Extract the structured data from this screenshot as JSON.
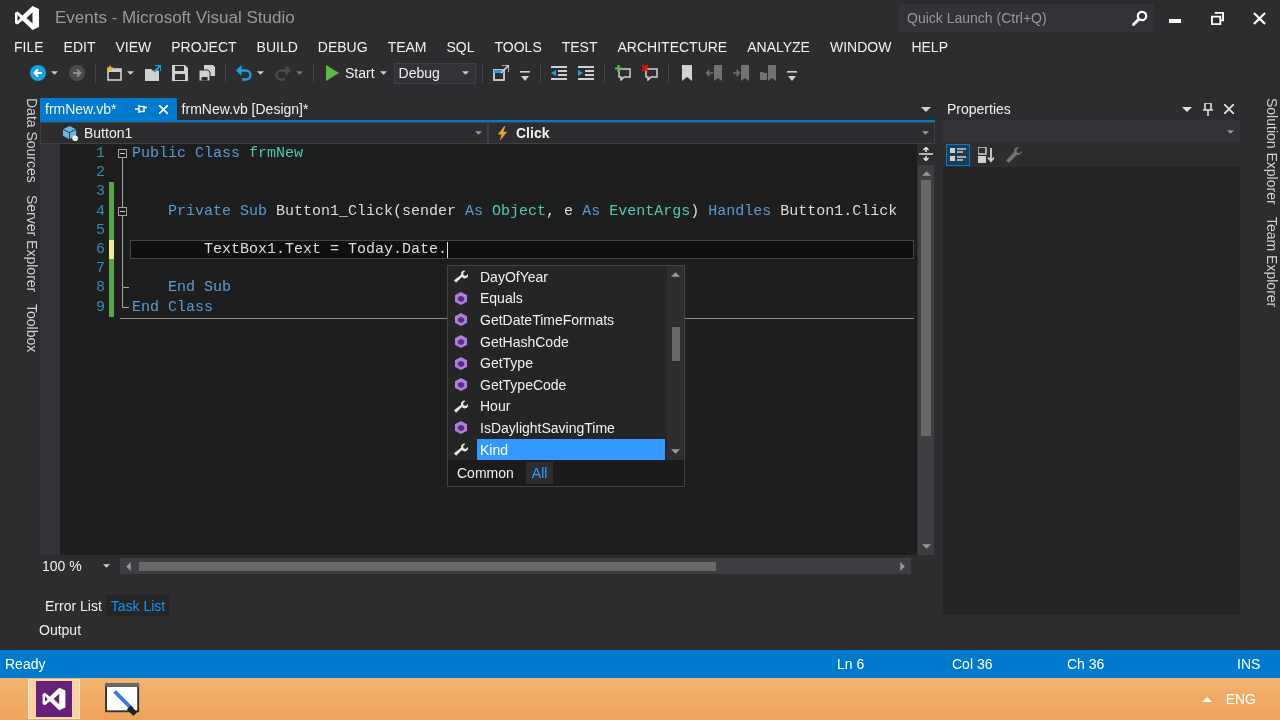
{
  "window": {
    "title": "Events - Microsoft Visual Studio"
  },
  "quick_launch": {
    "placeholder": "Quick Launch (Ctrl+Q)"
  },
  "menu": [
    "FILE",
    "EDIT",
    "VIEW",
    "PROJECT",
    "BUILD",
    "DEBUG",
    "TEAM",
    "SQL",
    "TOOLS",
    "TEST",
    "ARCHITECTURE",
    "ANALYZE",
    "WINDOW",
    "HELP"
  ],
  "toolbar": {
    "groups": [
      [
        {
          "kind": "back",
          "disabled": false,
          "dropdown": true
        },
        {
          "kind": "forward",
          "disabled": true,
          "dropdown": false
        }
      ],
      [
        {
          "kind": "new-project",
          "disabled": false,
          "dropdown": true
        },
        {
          "kind": "open",
          "disabled": false,
          "dropdown": false
        },
        {
          "kind": "save",
          "disabled": false,
          "dropdown": false
        },
        {
          "kind": "save-all",
          "disabled": false,
          "dropdown": false
        }
      ],
      [
        {
          "kind": "undo",
          "disabled": false,
          "dropdown": true
        },
        {
          "kind": "redo",
          "disabled": true,
          "dropdown": true
        }
      ],
      [
        {
          "kind": "start",
          "label": "Start",
          "disabled": false,
          "dropdown": true
        },
        {
          "kind": "configuration",
          "value": "Debug",
          "disabled": false
        }
      ],
      [
        {
          "kind": "browse",
          "disabled": false,
          "dropdown": false
        },
        {
          "kind": "overflow",
          "disabled": false,
          "dropdown": false
        }
      ],
      [
        {
          "kind": "outdent",
          "disabled": false,
          "dropdown": false
        },
        {
          "kind": "indent",
          "disabled": false,
          "dropdown": false
        }
      ],
      [
        {
          "kind": "comment",
          "disabled": false,
          "dropdown": false
        },
        {
          "kind": "uncomment",
          "disabled": false,
          "dropdown": false
        }
      ],
      [
        {
          "kind": "bookmark",
          "disabled": false,
          "dropdown": false
        },
        {
          "kind": "previous-bookmark",
          "disabled": true,
          "dropdown": false
        },
        {
          "kind": "next-bookmark",
          "disabled": true,
          "dropdown": false
        },
        {
          "kind": "next-bookmark-folder",
          "disabled": true,
          "dropdown": false
        },
        {
          "kind": "overflow",
          "disabled": false,
          "dropdown": false
        }
      ]
    ]
  },
  "side_tabs": {
    "left": [
      "Data Sources",
      "Server Explorer",
      "Toolbox"
    ],
    "right": [
      "Solution Explorer",
      "Team Explorer"
    ]
  },
  "documents": [
    {
      "label": "frmNew.vb*",
      "selected": true
    },
    {
      "label": "frmNew.vb [Design]*",
      "selected": false
    }
  ],
  "navigation": {
    "object": "Button1",
    "member": "Click"
  },
  "code": [
    {
      "number": "1",
      "region_start": true,
      "region_end": false,
      "modified": false,
      "current": false,
      "tokens": [
        {
          "kind": "keyword",
          "text": "Public Class "
        },
        {
          "kind": "type",
          "text": "frmNew"
        }
      ]
    },
    {
      "number": "2",
      "region_start": false,
      "region_end": false,
      "modified": false,
      "current": false
    },
    {
      "number": "3",
      "region_start": false,
      "region_end": false,
      "modified": true,
      "saved": true,
      "current": false
    },
    {
      "number": "4",
      "region_start": true,
      "region_end": false,
      "modified": true,
      "saved": true,
      "current": false,
      "tokens": [
        {
          "kind": "keyword",
          "text": "    Private Sub "
        },
        {
          "kind": "plain",
          "text": "Button1_Click(sender "
        },
        {
          "kind": "keyword",
          "text": "As "
        },
        {
          "kind": "type",
          "text": "Object"
        },
        {
          "kind": "plain",
          "text": ", e "
        },
        {
          "kind": "keyword",
          "text": "As "
        },
        {
          "kind": "type",
          "text": "EventArgs"
        },
        {
          "kind": "plain",
          "text": ") "
        },
        {
          "kind": "keyword",
          "text": "Handles "
        },
        {
          "kind": "plain",
          "text": "Button1.Click"
        }
      ]
    },
    {
      "number": "5",
      "region_start": false,
      "region_end": false,
      "modified": true,
      "saved": true,
      "current": false
    },
    {
      "number": "6",
      "region_start": false,
      "region_end": false,
      "modified": true,
      "saved": false,
      "current": true,
      "tokens": [
        {
          "kind": "plain",
          "text": "        TextBox1.Text = Today.Date."
        }
      ]
    },
    {
      "number": "7",
      "region_start": false,
      "region_end": false,
      "modified": true,
      "saved": true,
      "current": false
    },
    {
      "number": "8",
      "region_start": false,
      "region_end": true,
      "modified": true,
      "saved": true,
      "current": false,
      "tokens": [
        {
          "kind": "keyword",
          "text": "    End Sub"
        }
      ]
    },
    {
      "number": "9",
      "region_start": false,
      "region_end": true,
      "modified": true,
      "saved": true,
      "current": false,
      "tokens": [
        {
          "kind": "keyword",
          "text": "End Class"
        }
      ]
    }
  ],
  "completion": {
    "items": [
      {
        "label": "DayOfYear",
        "kind": "property",
        "selected": false
      },
      {
        "label": "Equals",
        "kind": "method",
        "selected": false
      },
      {
        "label": "GetDateTimeFormats",
        "kind": "method",
        "selected": false
      },
      {
        "label": "GetHashCode",
        "kind": "method",
        "selected": false
      },
      {
        "label": "GetType",
        "kind": "method",
        "selected": false
      },
      {
        "label": "GetTypeCode",
        "kind": "method",
        "selected": false
      },
      {
        "label": "Hour",
        "kind": "property",
        "selected": false
      },
      {
        "label": "IsDaylightSavingTime",
        "kind": "method",
        "selected": false
      },
      {
        "label": "Kind",
        "kind": "property",
        "selected": true
      }
    ],
    "tabs": [
      {
        "label": "Common",
        "selected": false
      },
      {
        "label": "All",
        "selected": true
      }
    ]
  },
  "editor_zoom": "100 %",
  "bottom_panel": {
    "tabs": [
      {
        "label": "Error List",
        "selected": false
      },
      {
        "label": "Task List",
        "selected": true
      }
    ],
    "output": "Output"
  },
  "properties": {
    "title": "Properties",
    "view_buttons": [
      {
        "kind": "categorized",
        "selected": true,
        "disabled": false
      },
      {
        "kind": "alphabetical",
        "selected": false,
        "disabled": false
      },
      {
        "kind": "property-pages",
        "selected": false,
        "disabled": true
      }
    ]
  },
  "status_bar": {
    "message": "Ready",
    "line": "Ln 6",
    "column": "Col 36",
    "character": "Ch 36",
    "mode": "INS"
  },
  "taskbar": {
    "apps": [
      {
        "kind": "visual-studio",
        "active": true
      },
      {
        "kind": "presentation",
        "active": false
      }
    ],
    "language": "ENG"
  }
}
